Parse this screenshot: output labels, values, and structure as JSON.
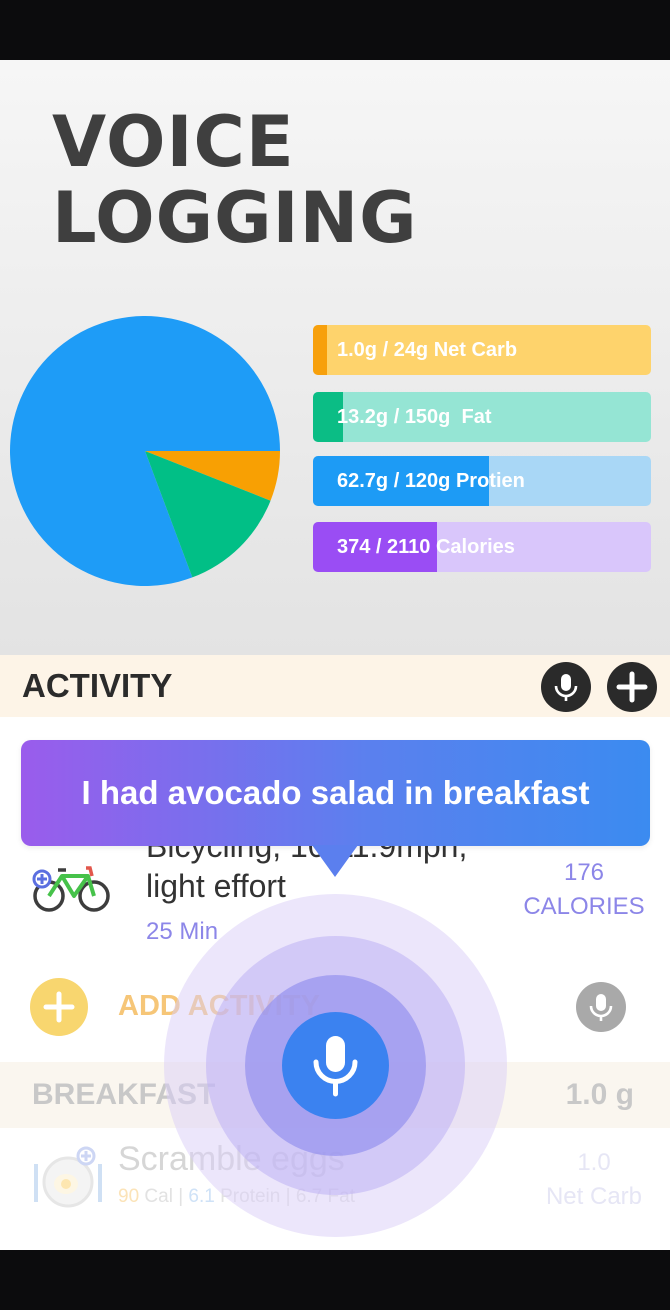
{
  "hero": {
    "title_line1": "VOICE",
    "title_line2": "LOGGING"
  },
  "chart_data": {
    "type": "pie",
    "values": [
      {
        "name": "Protein",
        "percent": 80.7,
        "color": "#1e9cf7"
      },
      {
        "name": "Net Carb",
        "percent": 6.0,
        "color": "#f8a003"
      },
      {
        "name": "Fat",
        "percent": 13.3,
        "color": "#01bf86"
      }
    ]
  },
  "macros": [
    {
      "label": "1.0g / 24g Net Carb",
      "fraction": 0.042,
      "track": "#fed36c",
      "fill": "#f7a00c"
    },
    {
      "label": "13.2g / 150g  Fat",
      "fraction": 0.088,
      "track": "#95e5d4",
      "fill": "#0bbd85"
    },
    {
      "label": "62.7g / 120g Protien",
      "fraction": 0.52,
      "track": "#a9d7f6",
      "fill": "#1d9bf5"
    },
    {
      "label": "374 / 2110 Calories",
      "fraction": 0.367,
      "track": "#d9c6fb",
      "fill": "#9a4df4"
    }
  ],
  "activity_section": {
    "title": "ACTIVITY",
    "mic_icon": "mic-icon",
    "plus_icon": "plus-icon"
  },
  "voice_bubble": {
    "text": "I had avocado salad in breakfast"
  },
  "activity_item": {
    "name_line1": "Bicycling, 10-11.9mph,",
    "name_line2": "light effort",
    "duration": "25 Min",
    "calories_value": "176",
    "calories_unit": "CALORIES",
    "icon": "bicycle-icon"
  },
  "add_activity": {
    "label": "ADD ACTIVITY"
  },
  "breakfast": {
    "title": "BREAKFAST",
    "amount": "1.0 g",
    "item": {
      "name": "Scramble eggs",
      "calories": "90",
      "calories_unit": " Cal | ",
      "protein": "6.1",
      "protein_unit": " Protein | ",
      "fat": "6.7",
      "fat_unit": " Fat",
      "carb_value": "1.0",
      "carb_unit": "Net Carb"
    }
  },
  "colors": {
    "accent_purple": "#8c86e8",
    "mic_blue": "#3b82f0"
  }
}
